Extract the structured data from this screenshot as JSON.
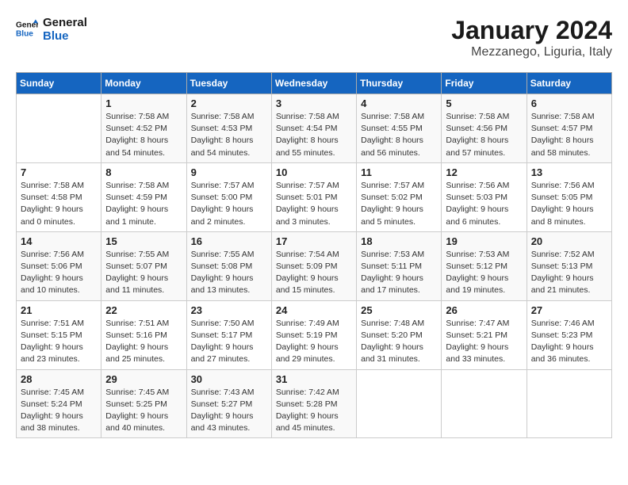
{
  "logo": {
    "line1": "General",
    "line2": "Blue"
  },
  "title": "January 2024",
  "location": "Mezzanego, Liguria, Italy",
  "days_header": [
    "Sunday",
    "Monday",
    "Tuesday",
    "Wednesday",
    "Thursday",
    "Friday",
    "Saturday"
  ],
  "weeks": [
    [
      {
        "num": "",
        "info": ""
      },
      {
        "num": "1",
        "info": "Sunrise: 7:58 AM\nSunset: 4:52 PM\nDaylight: 8 hours\nand 54 minutes."
      },
      {
        "num": "2",
        "info": "Sunrise: 7:58 AM\nSunset: 4:53 PM\nDaylight: 8 hours\nand 54 minutes."
      },
      {
        "num": "3",
        "info": "Sunrise: 7:58 AM\nSunset: 4:54 PM\nDaylight: 8 hours\nand 55 minutes."
      },
      {
        "num": "4",
        "info": "Sunrise: 7:58 AM\nSunset: 4:55 PM\nDaylight: 8 hours\nand 56 minutes."
      },
      {
        "num": "5",
        "info": "Sunrise: 7:58 AM\nSunset: 4:56 PM\nDaylight: 8 hours\nand 57 minutes."
      },
      {
        "num": "6",
        "info": "Sunrise: 7:58 AM\nSunset: 4:57 PM\nDaylight: 8 hours\nand 58 minutes."
      }
    ],
    [
      {
        "num": "7",
        "info": "Sunrise: 7:58 AM\nSunset: 4:58 PM\nDaylight: 9 hours\nand 0 minutes."
      },
      {
        "num": "8",
        "info": "Sunrise: 7:58 AM\nSunset: 4:59 PM\nDaylight: 9 hours\nand 1 minute."
      },
      {
        "num": "9",
        "info": "Sunrise: 7:57 AM\nSunset: 5:00 PM\nDaylight: 9 hours\nand 2 minutes."
      },
      {
        "num": "10",
        "info": "Sunrise: 7:57 AM\nSunset: 5:01 PM\nDaylight: 9 hours\nand 3 minutes."
      },
      {
        "num": "11",
        "info": "Sunrise: 7:57 AM\nSunset: 5:02 PM\nDaylight: 9 hours\nand 5 minutes."
      },
      {
        "num": "12",
        "info": "Sunrise: 7:56 AM\nSunset: 5:03 PM\nDaylight: 9 hours\nand 6 minutes."
      },
      {
        "num": "13",
        "info": "Sunrise: 7:56 AM\nSunset: 5:05 PM\nDaylight: 9 hours\nand 8 minutes."
      }
    ],
    [
      {
        "num": "14",
        "info": "Sunrise: 7:56 AM\nSunset: 5:06 PM\nDaylight: 9 hours\nand 10 minutes."
      },
      {
        "num": "15",
        "info": "Sunrise: 7:55 AM\nSunset: 5:07 PM\nDaylight: 9 hours\nand 11 minutes."
      },
      {
        "num": "16",
        "info": "Sunrise: 7:55 AM\nSunset: 5:08 PM\nDaylight: 9 hours\nand 13 minutes."
      },
      {
        "num": "17",
        "info": "Sunrise: 7:54 AM\nSunset: 5:09 PM\nDaylight: 9 hours\nand 15 minutes."
      },
      {
        "num": "18",
        "info": "Sunrise: 7:53 AM\nSunset: 5:11 PM\nDaylight: 9 hours\nand 17 minutes."
      },
      {
        "num": "19",
        "info": "Sunrise: 7:53 AM\nSunset: 5:12 PM\nDaylight: 9 hours\nand 19 minutes."
      },
      {
        "num": "20",
        "info": "Sunrise: 7:52 AM\nSunset: 5:13 PM\nDaylight: 9 hours\nand 21 minutes."
      }
    ],
    [
      {
        "num": "21",
        "info": "Sunrise: 7:51 AM\nSunset: 5:15 PM\nDaylight: 9 hours\nand 23 minutes."
      },
      {
        "num": "22",
        "info": "Sunrise: 7:51 AM\nSunset: 5:16 PM\nDaylight: 9 hours\nand 25 minutes."
      },
      {
        "num": "23",
        "info": "Sunrise: 7:50 AM\nSunset: 5:17 PM\nDaylight: 9 hours\nand 27 minutes."
      },
      {
        "num": "24",
        "info": "Sunrise: 7:49 AM\nSunset: 5:19 PM\nDaylight: 9 hours\nand 29 minutes."
      },
      {
        "num": "25",
        "info": "Sunrise: 7:48 AM\nSunset: 5:20 PM\nDaylight: 9 hours\nand 31 minutes."
      },
      {
        "num": "26",
        "info": "Sunrise: 7:47 AM\nSunset: 5:21 PM\nDaylight: 9 hours\nand 33 minutes."
      },
      {
        "num": "27",
        "info": "Sunrise: 7:46 AM\nSunset: 5:23 PM\nDaylight: 9 hours\nand 36 minutes."
      }
    ],
    [
      {
        "num": "28",
        "info": "Sunrise: 7:45 AM\nSunset: 5:24 PM\nDaylight: 9 hours\nand 38 minutes."
      },
      {
        "num": "29",
        "info": "Sunrise: 7:45 AM\nSunset: 5:25 PM\nDaylight: 9 hours\nand 40 minutes."
      },
      {
        "num": "30",
        "info": "Sunrise: 7:43 AM\nSunset: 5:27 PM\nDaylight: 9 hours\nand 43 minutes."
      },
      {
        "num": "31",
        "info": "Sunrise: 7:42 AM\nSunset: 5:28 PM\nDaylight: 9 hours\nand 45 minutes."
      },
      {
        "num": "",
        "info": ""
      },
      {
        "num": "",
        "info": ""
      },
      {
        "num": "",
        "info": ""
      }
    ]
  ]
}
